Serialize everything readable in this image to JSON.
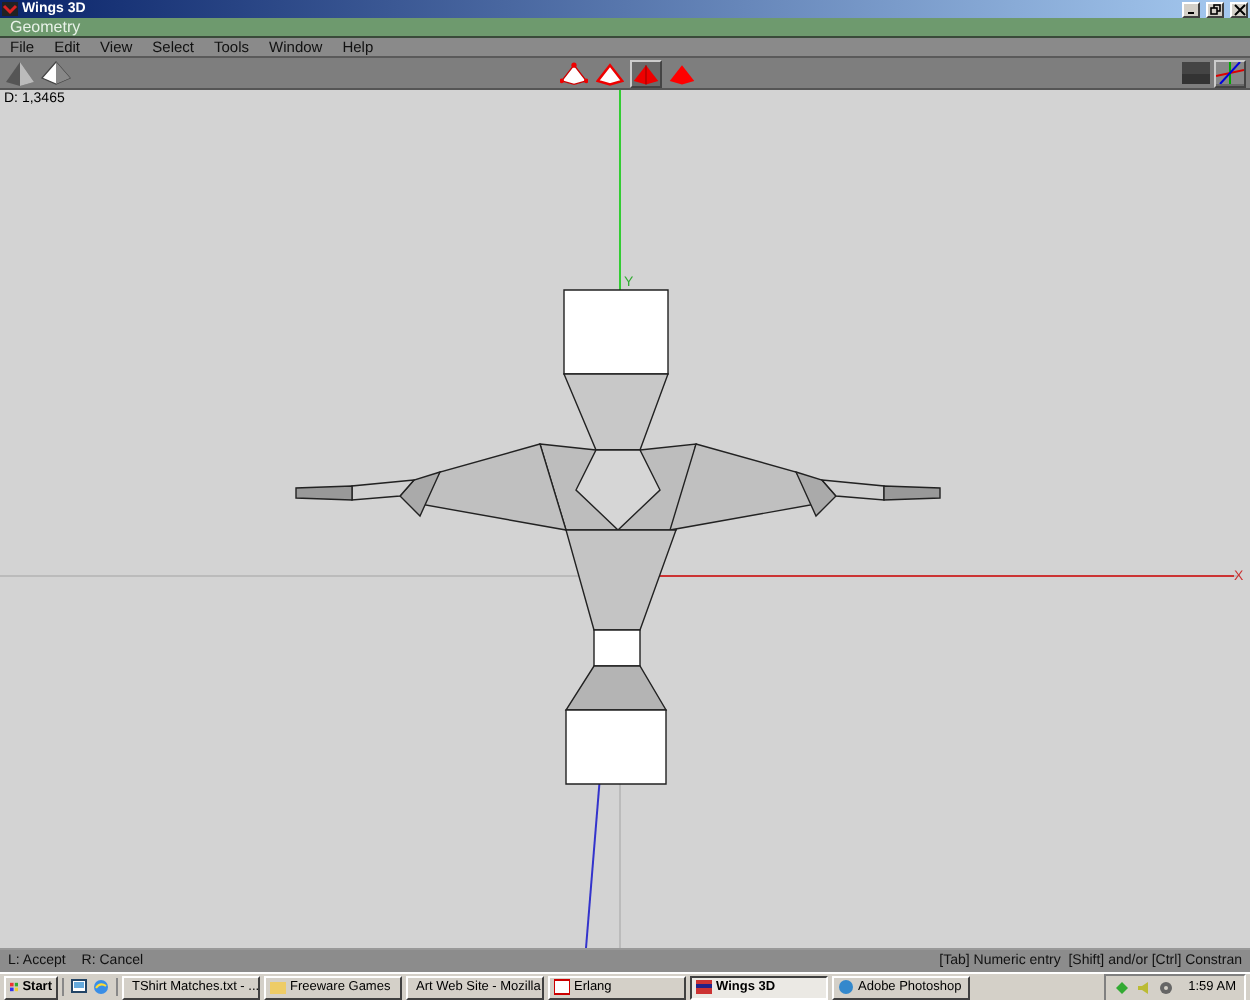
{
  "window": {
    "title": "Wings 3D"
  },
  "geometry_bar": {
    "title": "Geometry"
  },
  "menu": [
    "File",
    "Edit",
    "View",
    "Select",
    "Tools",
    "Window",
    "Help"
  ],
  "toolbar": {
    "modes": [
      {
        "kind": "vertex",
        "selected": false
      },
      {
        "kind": "edge",
        "selected": false
      },
      {
        "kind": "face",
        "selected": true
      },
      {
        "kind": "body",
        "selected": false
      }
    ]
  },
  "viewport": {
    "distance": "D: 1,3465",
    "axis_labels": [
      {
        "kind": "y",
        "text": "Y"
      },
      {
        "kind": "x",
        "text": "X"
      }
    ]
  },
  "status_bar": {
    "left": [
      "L: Accept",
      "R: Cancel"
    ],
    "right": "[Tab] Numeric entry  [Shift] and/or [Ctrl] Constran"
  },
  "taskbar": {
    "start": "Start",
    "tasks": [
      {
        "label": "TShirt Matches.txt - ...",
        "selected": false
      },
      {
        "label": "Freeware Games",
        "selected": false
      },
      {
        "label": "Art Web Site - Mozilla",
        "selected": false
      },
      {
        "label": "Erlang",
        "selected": false
      },
      {
        "label": "Wings 3D",
        "selected": true
      },
      {
        "label": "Adobe Photoshop",
        "selected": false
      }
    ],
    "clock": "1:59 AM"
  }
}
